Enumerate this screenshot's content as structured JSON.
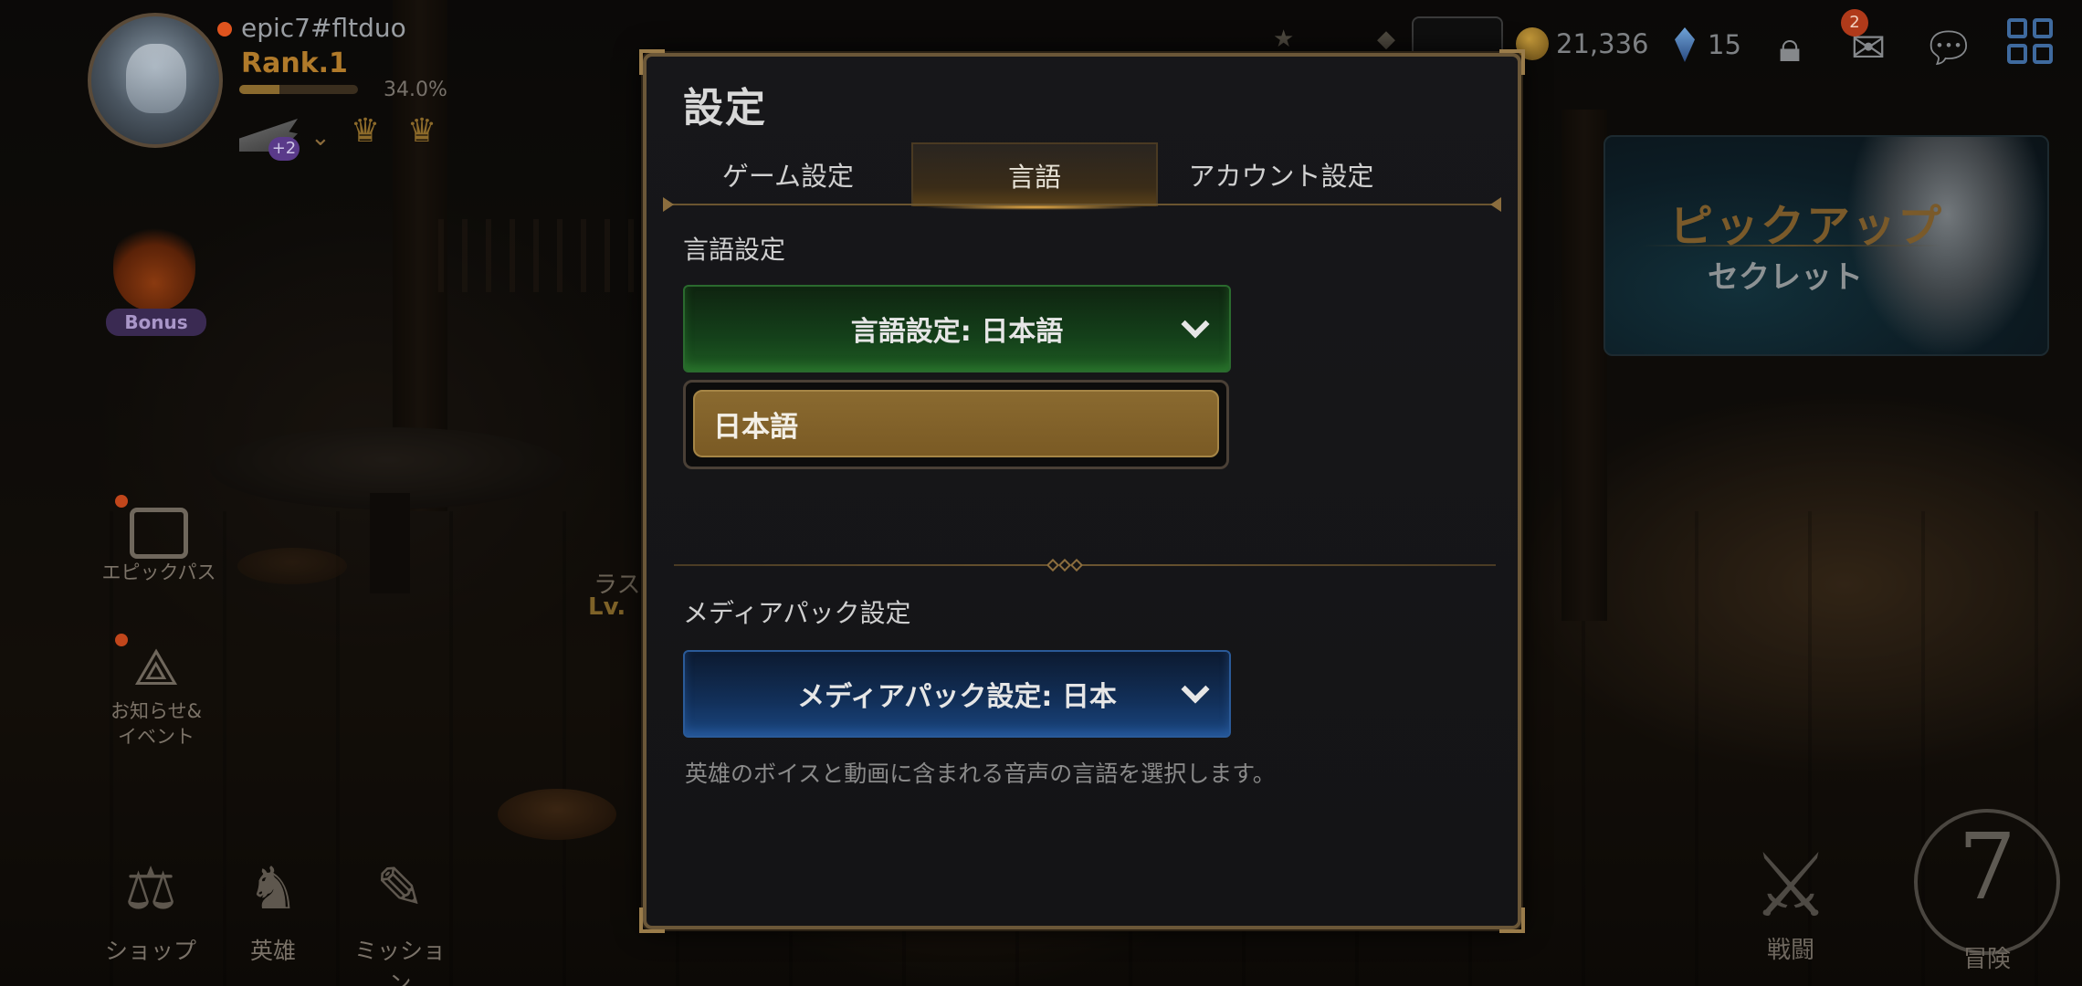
{
  "hud": {
    "user_name": "epic7#fltduo",
    "rank": "Rank.1",
    "exp_percent": "34.0%",
    "exp_fraction": 0.34,
    "wing_level": "+2",
    "gold": "21,336",
    "crystals": "15",
    "mail_count": "2"
  },
  "side_menu": {
    "bonus": "Bonus",
    "epic_pass": "エピックパス",
    "news_line1": "お知らせ&",
    "news_line2": "イベント"
  },
  "bottom_menu": {
    "shop": "ショップ",
    "heroes": "英雄",
    "missions": "ミッション"
  },
  "background_text": {
    "partial_label": "ラス",
    "partial_level": "Lv."
  },
  "pickup_banner": {
    "title": "ピックアップ",
    "subtitle": "セクレット"
  },
  "bottom_right": {
    "battle": "戦闘",
    "adventure": "冒険",
    "episode_number": "7"
  },
  "settings": {
    "title": "設定",
    "tabs": [
      {
        "label": "ゲーム設定",
        "active": false
      },
      {
        "label": "言語",
        "active": true
      },
      {
        "label": "アカウント設定",
        "active": false
      }
    ],
    "language_section": {
      "label": "言語設定",
      "dropdown_value": "言語設定: 日本語",
      "options": [
        "日本語"
      ]
    },
    "media_section": {
      "label": "メディアパック設定",
      "dropdown_value": "メディアパック設定: 日本",
      "hint": "英雄のボイスと動画に含まれる音声の言語を選択します。"
    }
  },
  "colors": {
    "accent_gold": "#9a7c4a",
    "language_dropdown": "#1e5a22",
    "media_dropdown": "#1a4680",
    "selected_option": "#8a6a30"
  },
  "icons": [
    "wing-icon",
    "crown-icon",
    "bonus-flame-icon",
    "epic-pass-icon",
    "news-event-icon",
    "shop-scale-icon",
    "hero-icon",
    "mission-scroll-icon",
    "gold-coin-icon",
    "crystal-icon",
    "lock-icon",
    "mail-icon",
    "chat-icon",
    "menu-grid-icon",
    "battle-swords-icon",
    "chevron-down-icon"
  ]
}
